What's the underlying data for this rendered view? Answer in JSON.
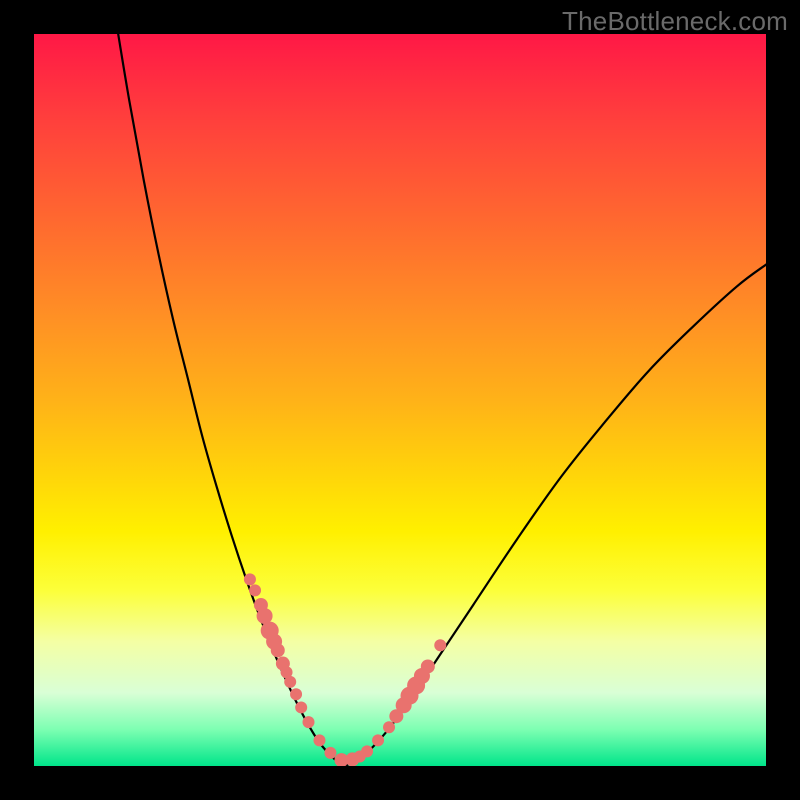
{
  "watermark": "TheBottleneck.com",
  "colors": {
    "frame_bg": "#000000",
    "curve": "#000000",
    "dot": "#e9726e",
    "gradient_top": "#ff1846",
    "gradient_bottom": "#00e58a"
  },
  "chart_data": {
    "type": "line",
    "title": "",
    "xlabel": "",
    "ylabel": "",
    "xlim": [
      0,
      100
    ],
    "ylim": [
      0,
      100
    ],
    "grid": false,
    "legend": false,
    "note": "V-shaped bottleneck curve with minimum near x≈42 at y≈0; scatter points cluster on both branches near the lower region. Axes are not labeled in the source image; values are estimated from pixel positions on a 0–100 normalized scale.",
    "series": [
      {
        "name": "curve_left_branch",
        "x": [
          11.5,
          13,
          15,
          17,
          19,
          21,
          23,
          25,
          27,
          29,
          31,
          33,
          35,
          37,
          39,
          41,
          42.5
        ],
        "y": [
          100,
          91,
          80,
          70,
          61,
          53,
          45,
          38,
          31.5,
          25.5,
          20,
          15,
          10.5,
          6.5,
          3.2,
          1.0,
          0
        ]
      },
      {
        "name": "curve_right_branch",
        "x": [
          42.5,
          45,
          48,
          51,
          55,
          60,
          66,
          72,
          78,
          84,
          90,
          96,
          100
        ],
        "y": [
          0,
          1.4,
          4.5,
          8.5,
          14.5,
          22,
          31,
          39.5,
          47,
          54,
          60,
          65.5,
          68.5
        ]
      }
    ],
    "scatter": {
      "name": "points",
      "x": [
        29.5,
        30.2,
        31.0,
        31.5,
        32.2,
        32.8,
        33.3,
        34.0,
        34.5,
        35.0,
        35.8,
        36.5,
        37.5,
        39.0,
        40.5,
        42.0,
        43.5,
        44.5,
        45.5,
        47.0,
        48.5,
        49.5,
        50.5,
        51.3,
        52.2,
        53.0,
        53.8,
        55.5
      ],
      "y": [
        25.5,
        24.0,
        22.0,
        20.5,
        18.5,
        17.0,
        15.8,
        14.0,
        12.8,
        11.5,
        9.8,
        8.0,
        6.0,
        3.5,
        1.8,
        0.8,
        0.9,
        1.3,
        2.0,
        3.5,
        5.3,
        6.8,
        8.3,
        9.6,
        11.0,
        12.3,
        13.6,
        16.5
      ],
      "r": [
        6,
        6,
        7,
        8,
        9,
        8,
        7,
        7,
        6,
        6,
        6,
        6,
        6,
        6,
        6,
        7,
        7,
        6,
        6,
        6,
        6,
        7,
        8,
        9,
        9,
        8,
        7,
        6
      ]
    }
  }
}
